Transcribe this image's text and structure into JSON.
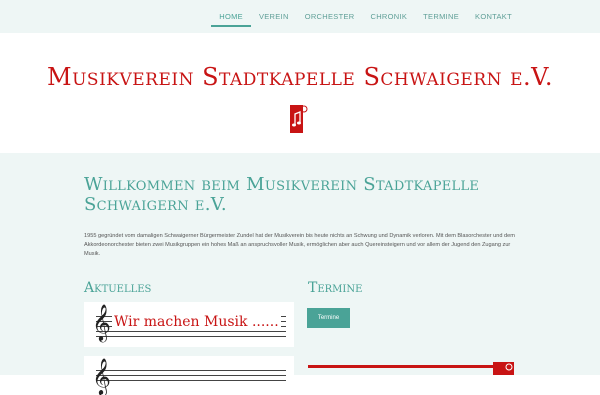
{
  "nav": {
    "items": [
      {
        "label": "HOME",
        "active": true
      },
      {
        "label": "VEREIN",
        "active": false
      },
      {
        "label": "ORCHESTER",
        "active": false
      },
      {
        "label": "CHRONIK",
        "active": false
      },
      {
        "label": "TERMINE",
        "active": false
      },
      {
        "label": "KONTAKT",
        "active": false
      }
    ]
  },
  "header": {
    "title": "Musikverein Stadtkapelle Schwaigern e.V."
  },
  "main": {
    "welcome_heading": "Willkommen beim Musikverein Stadtkapelle Schwaigern e.V.",
    "intro_text": "1955 gegründet vom damaligen Schwaigerner Bürgermeister Zundel hat der Musikverein bis heute nichts an Schwung und Dynamik verloren. Mit dem Blasorchester und dem Akkordeonorchester bieten zwei Musikgruppen ein hohes Maß an anspruchsvoller Musik, ermöglichen aber auch Quereinsteigern und vor allem der Jugend den Zugang zur Musik.",
    "aktuelles_heading": "Aktuelles",
    "termine_heading": "Termine",
    "termine_button": "Termine",
    "news": [
      {
        "text": "Wir machen Musik ......"
      }
    ]
  },
  "colors": {
    "accent": "#4aa397",
    "brand_red": "#c81414",
    "background_light": "#eef6f5"
  }
}
